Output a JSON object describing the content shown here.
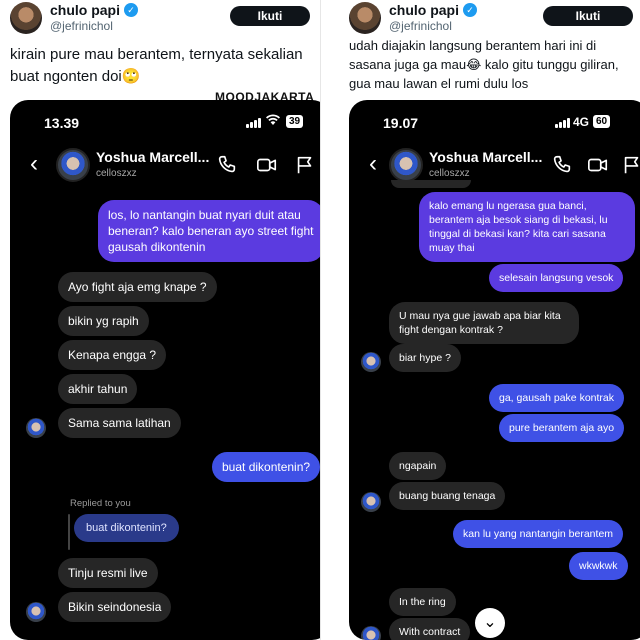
{
  "left_post": {
    "author_name": "chulo papi",
    "author_handle": "@jefrinichol",
    "follow_label": "Ikuti",
    "text": "kirain pure mau berantem, ternyata sekalian buat ngonten doi🙄",
    "watermark": "MOODJAKARTA",
    "phone": {
      "time": "13.39",
      "battery": "39",
      "chat_name": "Yoshua Marcell...",
      "chat_username": "celloszxz",
      "replied_label": "Replied to you",
      "reply_quote": "buat dikontenin?",
      "messages": [
        "los, lo nantangin buat nyari duit atau beneran? kalo beneran ayo street fight gausah dikontenin",
        "Ayo fight aja emg knape ?",
        "bikin yg rapih",
        "Kenapa engga ?",
        "akhir tahun",
        "Sama sama latihan",
        "buat dikontenin?",
        "Tinju resmi live",
        "Bikin seindonesia"
      ]
    }
  },
  "right_post": {
    "author_name": "chulo papi",
    "author_handle": "@jefrinichol",
    "follow_label": "Ikuti",
    "text": "udah diajakin langsung berantem hari ini di sasana juga ga mau😂 kalo gitu tunggu giliran, gua mau lawan el rumi dulu los",
    "phone": {
      "time": "19.07",
      "network": "4G",
      "battery": "60",
      "chat_name": "Yoshua Marcell...",
      "chat_username": "celloszxz",
      "messages": [
        "kalo emang lu ngerasa gua banci, berantem aja besok siang di bekasi, lu tinggal di bekasi kan? kita cari sasana muay thai",
        "selesain langsung vesok",
        "U mau nya gue jawab apa biar kita fight dengan kontrak ?",
        "biar hype ?",
        "ga, gausah pake kontrak",
        "pure berantem aja ayo",
        "ngapain",
        "buang buang tenaga",
        "kan lu yang nantangin berantem",
        "wkwkwk",
        "In the ring",
        "With contract"
      ]
    }
  },
  "icons": [
    "verified-icon",
    "back-icon",
    "phone-call-icon",
    "video-call-icon",
    "flag-icon",
    "signal-icon",
    "wifi-icon",
    "chevron-down-icon"
  ]
}
